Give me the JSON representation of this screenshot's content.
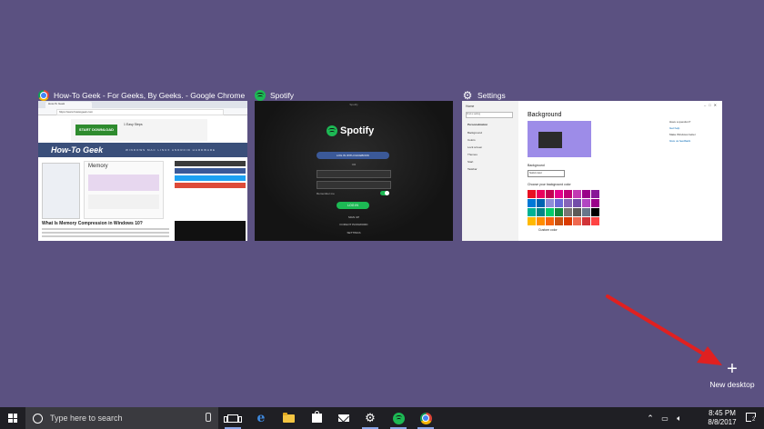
{
  "windows": [
    {
      "title": "How-To Geek - For Geeks, By Geeks. - Google Chrome",
      "icon": "chrome-icon"
    },
    {
      "title": "Spotify",
      "icon": "spotify-icon"
    },
    {
      "title": "Settings",
      "icon": "gear-icon"
    }
  ],
  "chrome_thumb": {
    "tab": "How-To Geek",
    "url": "https://www.howtogeek.com",
    "ad_button": "START DOWNLOAD",
    "ad_text": "1 Easy Steps",
    "logo": "How-To Geek",
    "nav": "WINDOWS  MAC  LINUX  ANDROID  HARDWARE",
    "article_box_title": "Memory",
    "headline": "What Is Memory Compression in Windows 10?"
  },
  "spotify_thumb": {
    "titlebar": "Spotify",
    "logo": "Spotify",
    "facebook_button": "LOG IN WITH FACEBOOK",
    "or": "OR",
    "remember": "Remember me",
    "login_button": "LOG IN",
    "links": [
      "SIGN UP",
      "FORGOT PASSWORD",
      "SETTINGS"
    ]
  },
  "settings_thumb": {
    "home": "Home",
    "search_placeholder": "Find a setting",
    "section": "Personalization",
    "items": [
      "Background",
      "Colors",
      "Lock screen",
      "Themes",
      "Start",
      "Taskbar"
    ],
    "title": "Background",
    "background_label": "Background",
    "background_value": "Solid color",
    "colors_label": "Choose your background color",
    "custom_color": "Custom color",
    "right_links": [
      "Have a question?",
      "Get help",
      "Make Windows better",
      "Give us feedback"
    ],
    "swatches": [
      "#e81123",
      "#ea005e",
      "#c30052",
      "#e3008c",
      "#bf0077",
      "#c239b3",
      "#9a0089",
      "#881798",
      "#0078d7",
      "#0063b1",
      "#8e8cd8",
      "#6b69d6",
      "#8764b8",
      "#744da9",
      "#b146c2",
      "#9a0089",
      "#00b294",
      "#038387",
      "#00cc6a",
      "#10893e",
      "#7a7574",
      "#5d5a58",
      "#68768a",
      "#000000",
      "#ffb900",
      "#ff8c00",
      "#f7630c",
      "#ca5010",
      "#da3b01",
      "#ef6950",
      "#d13438",
      "#ff4343"
    ]
  },
  "new_desktop": {
    "label": "New desktop"
  },
  "taskbar": {
    "search_placeholder": "Type here to search",
    "time": "8:45 PM",
    "date": "8/8/2017",
    "notification_count": "2"
  },
  "colors": {
    "desktop_bg": "#5b5181",
    "taskbar_bg": "#1f1f24",
    "arrow": "#e02020"
  }
}
